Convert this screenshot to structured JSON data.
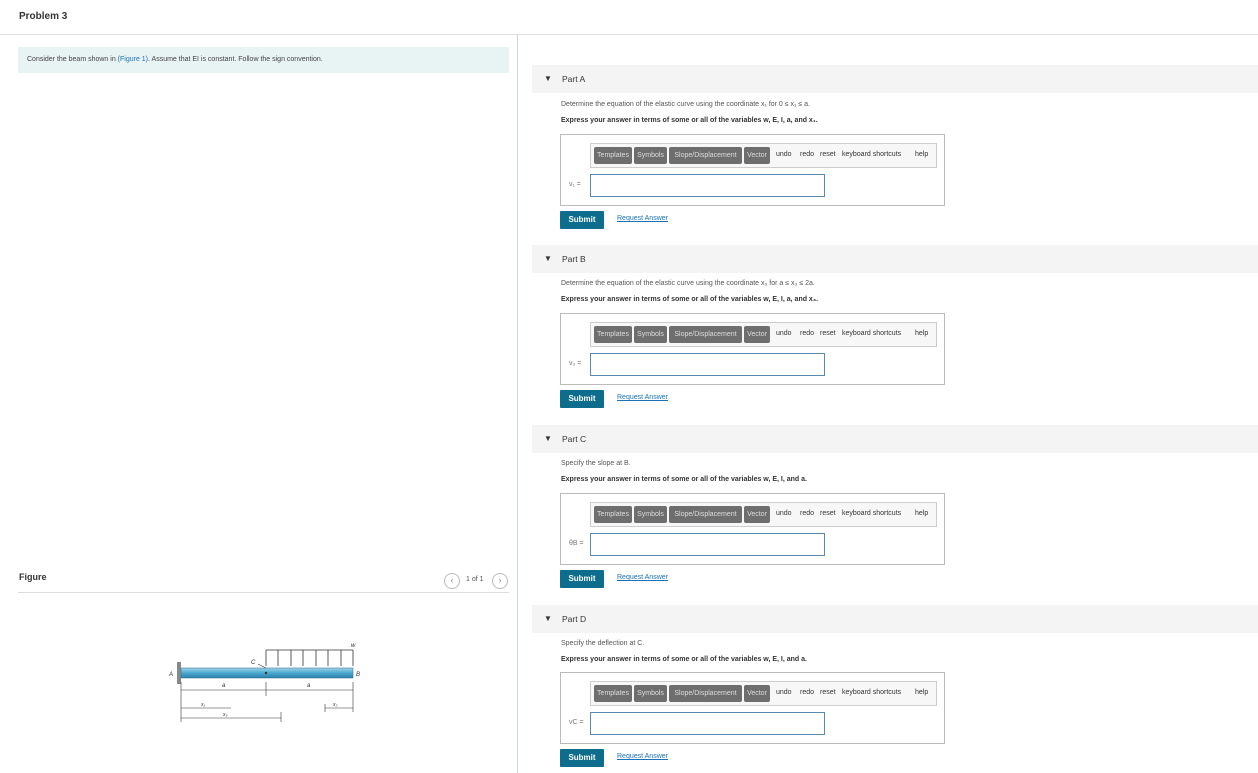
{
  "page": {
    "title": "Problem 3"
  },
  "intro": {
    "prefix": "Consider the beam shown in ",
    "link": "(Figure 1)",
    "suffix": ". Assume that EI is constant. Follow the sign convention."
  },
  "figure": {
    "title": "Figure",
    "counter": "1 of 1",
    "labels": {
      "A": "A",
      "B": "B",
      "C": "C",
      "w": "w",
      "a1": "a",
      "a2": "a",
      "x1": "x₁",
      "x2": "x₂",
      "x3": "x₃"
    }
  },
  "toolbar": {
    "templates": "Templates",
    "symbols": "Symbols",
    "slope": "Slope/Displacement",
    "vector": "Vector",
    "undo": "undo",
    "redo": "redo",
    "reset": "reset",
    "keyboard": "keyboard shortcuts",
    "help": "help"
  },
  "parts": [
    {
      "label": "Part A",
      "question": "Determine the equation of the elastic curve using the coordinate x₁ for 0 ≤ x₁ ≤ a.",
      "instruction": "Express your answer in terms of some or all of the variables w, E, I, a, and x₁.",
      "var": "v₁ =",
      "submit": "Submit",
      "request": "Request Answer",
      "input": ""
    },
    {
      "label": "Part B",
      "question": "Determine the equation of the elastic curve using the coordinate x₃ for a ≤ x₃ ≤ 2a.",
      "instruction": "Express your answer in terms of some or all of the variables w, E, I, a, and x₃.",
      "var": "v₃ =",
      "submit": "Submit",
      "request": "Request Answer",
      "input": ""
    },
    {
      "label": "Part C",
      "question": "Specify the slope at B.",
      "instruction": "Express your answer in terms of some or all of the variables w, E, I, and a.",
      "var": "θB =",
      "submit": "Submit",
      "request": "Request Answer",
      "input": ""
    },
    {
      "label": "Part D",
      "question": "Specify the deflection at C.",
      "instruction": "Express your answer in terms of some or all of the variables w, E, I, and a.",
      "var": "vC =",
      "submit": "Submit",
      "request": "Request Answer",
      "input": ""
    }
  ]
}
